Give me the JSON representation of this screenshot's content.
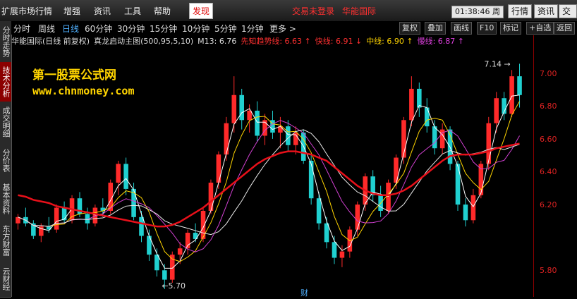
{
  "menubar": {
    "items": [
      "扩展市场行情",
      "增强",
      "资讯",
      "工具",
      "帮助"
    ],
    "active_item": "发现",
    "login_status": "交易未登录",
    "stock_name": "华能国际",
    "clock": "01:38:46 周二",
    "right_buttons": [
      "行情",
      "资讯",
      "交易"
    ]
  },
  "toolbar": {
    "periods": [
      "分时",
      "周线",
      "日线",
      "60分钟",
      "30分钟",
      "15分钟",
      "10分钟",
      "5分钟",
      "1分钟",
      "更多 >"
    ],
    "selected_period": "日线",
    "buttons": [
      "复权",
      "叠加",
      "画线",
      "F10",
      "标记",
      "+自选",
      "返回"
    ]
  },
  "sidebar": {
    "tabs": [
      "分时走势",
      "技术分析",
      "成交明细",
      "分价表",
      "基本资料",
      "东方财富",
      "云财经"
    ],
    "selected": "技术分析"
  },
  "indicator": {
    "stock_title": "华能国际(日线 前复权)",
    "formula": "真龙启动主图(500,95,5,10)",
    "m13": "M13: 6.76",
    "trend_line": "先知趋势线: 6.63 ↑",
    "fast_line": "快线: 6.91 ↓",
    "mid_line": "中线: 6.90 ↑",
    "slow_line": "慢线: 6.87 ↑"
  },
  "watermark": {
    "line1": "第一股票公式网",
    "line2": "www.chnmoney.com"
  },
  "chart": {
    "high_label": "7.14",
    "low_label": "5.70",
    "bottom_marker": "财",
    "colors": {
      "up": "#ff2a2a",
      "down": "#20d0d0",
      "trend": "#e8101a"
    }
  },
  "yaxis": {
    "ticks": [
      "7.00",
      "6.80",
      "6.60",
      "6.40",
      "6.20",
      "5.80"
    ]
  },
  "chart_data": {
    "type": "candlestick",
    "y_range": [
      5.65,
      7.25
    ],
    "candles": [
      [
        6.12,
        6.18,
        6.08,
        6.16
      ],
      [
        6.16,
        6.22,
        6.1,
        6.12
      ],
      [
        6.12,
        6.14,
        6.02,
        6.04
      ],
      [
        6.04,
        6.12,
        6.0,
        6.1
      ],
      [
        6.1,
        6.16,
        6.06,
        6.08
      ],
      [
        6.08,
        6.24,
        6.06,
        6.22
      ],
      [
        6.22,
        6.26,
        6.12,
        6.14
      ],
      [
        6.14,
        6.3,
        6.12,
        6.28
      ],
      [
        6.28,
        6.32,
        6.16,
        6.18
      ],
      [
        6.18,
        6.22,
        6.08,
        6.12
      ],
      [
        6.12,
        6.24,
        6.1,
        6.22
      ],
      [
        6.22,
        6.28,
        6.16,
        6.2
      ],
      [
        6.2,
        6.4,
        6.18,
        6.38
      ],
      [
        6.38,
        6.52,
        6.3,
        6.5
      ],
      [
        6.5,
        6.54,
        6.3,
        6.34
      ],
      [
        6.34,
        6.38,
        6.14,
        6.16
      ],
      [
        6.16,
        6.2,
        6.0,
        6.04
      ],
      [
        6.04,
        6.08,
        5.88,
        5.92
      ],
      [
        5.92,
        5.96,
        5.78,
        5.82
      ],
      [
        5.82,
        5.86,
        5.7,
        5.76
      ],
      [
        5.76,
        5.94,
        5.74,
        5.92
      ],
      [
        5.92,
        6.0,
        5.86,
        5.96
      ],
      [
        5.96,
        6.08,
        5.92,
        6.06
      ],
      [
        6.06,
        6.12,
        6.0,
        6.02
      ],
      [
        6.02,
        6.22,
        6.0,
        6.2
      ],
      [
        6.2,
        6.4,
        6.18,
        6.38
      ],
      [
        6.38,
        6.58,
        6.34,
        6.56
      ],
      [
        6.56,
        6.8,
        6.52,
        6.76
      ],
      [
        6.76,
        7.06,
        6.7,
        6.94
      ],
      [
        6.94,
        6.98,
        6.72,
        6.78
      ],
      [
        6.78,
        6.88,
        6.7,
        6.84
      ],
      [
        6.84,
        6.9,
        6.64,
        6.68
      ],
      [
        6.68,
        6.82,
        6.62,
        6.78
      ],
      [
        6.78,
        6.84,
        6.66,
        6.7
      ],
      [
        6.7,
        6.8,
        6.6,
        6.74
      ],
      [
        6.74,
        6.78,
        6.58,
        6.62
      ],
      [
        6.62,
        6.74,
        6.56,
        6.7
      ],
      [
        6.7,
        6.72,
        6.5,
        6.52
      ],
      [
        6.52,
        6.56,
        6.24,
        6.28
      ],
      [
        6.28,
        6.32,
        6.08,
        6.12
      ],
      [
        6.12,
        6.16,
        5.96,
        6.0
      ],
      [
        6.0,
        6.04,
        5.86,
        5.9
      ],
      [
        5.9,
        5.98,
        5.84,
        5.94
      ],
      [
        5.94,
        6.1,
        5.9,
        6.08
      ],
      [
        6.08,
        6.26,
        6.04,
        6.24
      ],
      [
        6.24,
        6.44,
        6.2,
        6.42
      ],
      [
        6.42,
        6.46,
        6.26,
        6.3
      ],
      [
        6.3,
        6.36,
        6.16,
        6.2
      ],
      [
        6.2,
        6.4,
        6.18,
        6.38
      ],
      [
        6.38,
        6.56,
        6.34,
        6.54
      ],
      [
        6.54,
        6.8,
        6.5,
        6.78
      ],
      [
        6.78,
        7.06,
        6.74,
        6.98
      ],
      [
        6.98,
        7.02,
        6.8,
        6.86
      ],
      [
        6.86,
        6.92,
        6.7,
        6.74
      ],
      [
        6.74,
        6.78,
        6.56,
        6.6
      ],
      [
        6.6,
        6.76,
        6.56,
        6.72
      ],
      [
        6.72,
        6.74,
        6.46,
        6.5
      ],
      [
        6.5,
        6.52,
        6.2,
        6.24
      ],
      [
        6.24,
        6.28,
        6.1,
        6.14
      ],
      [
        6.14,
        6.34,
        6.12,
        6.3
      ],
      [
        6.3,
        6.52,
        6.28,
        6.5
      ],
      [
        6.5,
        6.8,
        6.46,
        6.76
      ],
      [
        6.76,
        6.96,
        6.7,
        6.92
      ],
      [
        6.92,
        6.96,
        6.78,
        6.82
      ],
      [
        6.82,
        7.1,
        6.8,
        7.06
      ],
      [
        7.06,
        7.14,
        6.86,
        6.94
      ]
    ],
    "trend_line": [
      6.3,
      6.29,
      6.27,
      6.26,
      6.25,
      6.23,
      6.22,
      6.21,
      6.2,
      6.19,
      6.18,
      6.17,
      6.16,
      6.15,
      6.14,
      6.13,
      6.12,
      6.11,
      6.1,
      6.1,
      6.11,
      6.13,
      6.16,
      6.19,
      6.22,
      6.26,
      6.3,
      6.34,
      6.38,
      6.42,
      6.46,
      6.5,
      6.53,
      6.55,
      6.57,
      6.58,
      6.58,
      6.57,
      6.56,
      6.54,
      6.52,
      6.48,
      6.44,
      6.4,
      6.36,
      6.33,
      6.31,
      6.3,
      6.3,
      6.31,
      6.33,
      6.36,
      6.4,
      6.44,
      6.48,
      6.52,
      6.55,
      6.56,
      6.56,
      6.56,
      6.57,
      6.58,
      6.6,
      6.61,
      6.62,
      6.63
    ]
  }
}
